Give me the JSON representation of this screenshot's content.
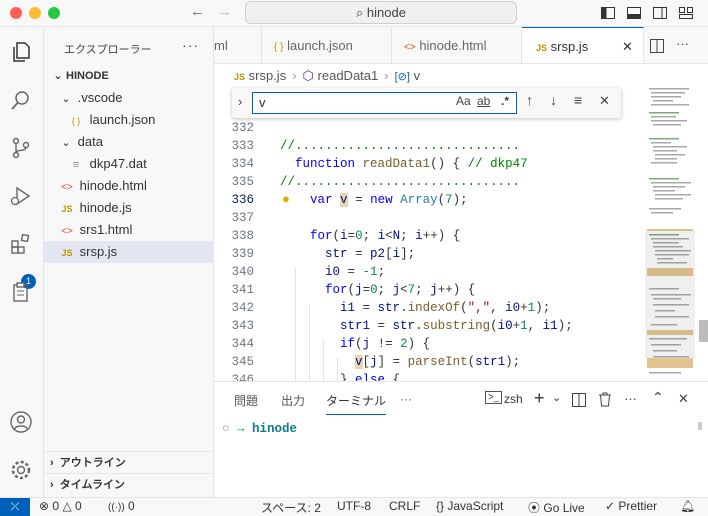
{
  "titlebar": {
    "search_text": "hinode",
    "back": "←",
    "forward": "→"
  },
  "activity": {
    "extensions_badge": "1"
  },
  "sidebar": {
    "title": "エクスプローラー",
    "more": "···",
    "project": "HINODE",
    "items": [
      {
        "label": ".vscode",
        "icon": "›"
      },
      {
        "label": "launch.json",
        "icon": "{ }"
      },
      {
        "label": "data",
        "icon": "›"
      },
      {
        "label": "dkp47.dat",
        "icon": "≡"
      },
      {
        "label": "hinode.html",
        "icon": "<>"
      },
      {
        "label": "hinode.js",
        "icon": "JS"
      },
      {
        "label": "srs1.html",
        "icon": "<>"
      },
      {
        "label": "srsp.js",
        "icon": "JS"
      }
    ],
    "outline": "アウトライン",
    "timeline": "タイムライン"
  },
  "tabs": [
    {
      "label": "ml",
      "icon": ""
    },
    {
      "label": "launch.json",
      "icon": "{ }"
    },
    {
      "label": "hinode.html",
      "icon": "<>"
    },
    {
      "label": "srsp.js",
      "icon": "JS"
    }
  ],
  "breadcrumb": {
    "file": "srsp.js",
    "fn": "readData1",
    "var": "v"
  },
  "find": {
    "value": "v",
    "case": "Aa",
    "word": "ab",
    "regex": ".*"
  },
  "editor": {
    "lines": [
      "332",
      "333",
      "334",
      "335",
      "336",
      "337",
      "338",
      "339",
      "340",
      "341",
      "342",
      "343",
      "344",
      "345",
      "346"
    ]
  },
  "panel": {
    "tabs": [
      "問題",
      "出力",
      "ターミナル"
    ],
    "more": "···",
    "shell": "zsh",
    "terminal_prompt": "hinode"
  },
  "status": {
    "errors": "0",
    "warnings": "0",
    "ports": "0",
    "spaces": "スペース: 2",
    "encoding": "UTF-8",
    "eol": "CRLF",
    "language": "JavaScript",
    "golive": "Go Live",
    "prettier": "Prettier"
  },
  "colors": {
    "accent": "#005fb8",
    "highlight": "#e9d4b0"
  }
}
